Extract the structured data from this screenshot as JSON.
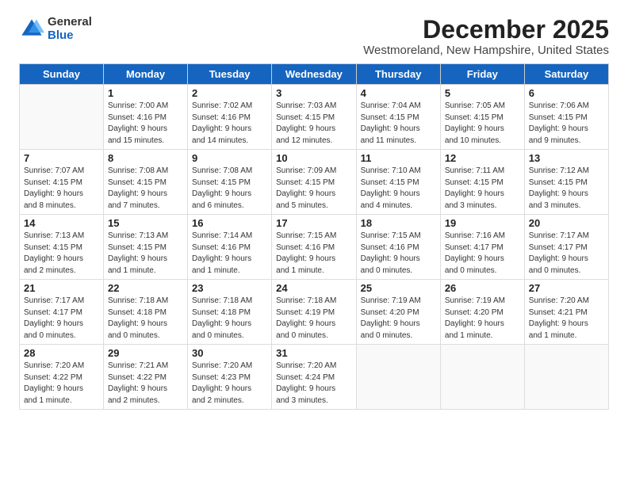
{
  "logo": {
    "general": "General",
    "blue": "Blue"
  },
  "title": "December 2025",
  "subtitle": "Westmoreland, New Hampshire, United States",
  "days_of_week": [
    "Sunday",
    "Monday",
    "Tuesday",
    "Wednesday",
    "Thursday",
    "Friday",
    "Saturday"
  ],
  "weeks": [
    [
      {
        "day": "",
        "info": ""
      },
      {
        "day": "1",
        "info": "Sunrise: 7:00 AM\nSunset: 4:16 PM\nDaylight: 9 hours\nand 15 minutes."
      },
      {
        "day": "2",
        "info": "Sunrise: 7:02 AM\nSunset: 4:16 PM\nDaylight: 9 hours\nand 14 minutes."
      },
      {
        "day": "3",
        "info": "Sunrise: 7:03 AM\nSunset: 4:15 PM\nDaylight: 9 hours\nand 12 minutes."
      },
      {
        "day": "4",
        "info": "Sunrise: 7:04 AM\nSunset: 4:15 PM\nDaylight: 9 hours\nand 11 minutes."
      },
      {
        "day": "5",
        "info": "Sunrise: 7:05 AM\nSunset: 4:15 PM\nDaylight: 9 hours\nand 10 minutes."
      },
      {
        "day": "6",
        "info": "Sunrise: 7:06 AM\nSunset: 4:15 PM\nDaylight: 9 hours\nand 9 minutes."
      }
    ],
    [
      {
        "day": "7",
        "info": "Sunrise: 7:07 AM\nSunset: 4:15 PM\nDaylight: 9 hours\nand 8 minutes."
      },
      {
        "day": "8",
        "info": "Sunrise: 7:08 AM\nSunset: 4:15 PM\nDaylight: 9 hours\nand 7 minutes."
      },
      {
        "day": "9",
        "info": "Sunrise: 7:08 AM\nSunset: 4:15 PM\nDaylight: 9 hours\nand 6 minutes."
      },
      {
        "day": "10",
        "info": "Sunrise: 7:09 AM\nSunset: 4:15 PM\nDaylight: 9 hours\nand 5 minutes."
      },
      {
        "day": "11",
        "info": "Sunrise: 7:10 AM\nSunset: 4:15 PM\nDaylight: 9 hours\nand 4 minutes."
      },
      {
        "day": "12",
        "info": "Sunrise: 7:11 AM\nSunset: 4:15 PM\nDaylight: 9 hours\nand 3 minutes."
      },
      {
        "day": "13",
        "info": "Sunrise: 7:12 AM\nSunset: 4:15 PM\nDaylight: 9 hours\nand 3 minutes."
      }
    ],
    [
      {
        "day": "14",
        "info": "Sunrise: 7:13 AM\nSunset: 4:15 PM\nDaylight: 9 hours\nand 2 minutes."
      },
      {
        "day": "15",
        "info": "Sunrise: 7:13 AM\nSunset: 4:15 PM\nDaylight: 9 hours\nand 1 minute."
      },
      {
        "day": "16",
        "info": "Sunrise: 7:14 AM\nSunset: 4:16 PM\nDaylight: 9 hours\nand 1 minute."
      },
      {
        "day": "17",
        "info": "Sunrise: 7:15 AM\nSunset: 4:16 PM\nDaylight: 9 hours\nand 1 minute."
      },
      {
        "day": "18",
        "info": "Sunrise: 7:15 AM\nSunset: 4:16 PM\nDaylight: 9 hours\nand 0 minutes."
      },
      {
        "day": "19",
        "info": "Sunrise: 7:16 AM\nSunset: 4:17 PM\nDaylight: 9 hours\nand 0 minutes."
      },
      {
        "day": "20",
        "info": "Sunrise: 7:17 AM\nSunset: 4:17 PM\nDaylight: 9 hours\nand 0 minutes."
      }
    ],
    [
      {
        "day": "21",
        "info": "Sunrise: 7:17 AM\nSunset: 4:17 PM\nDaylight: 9 hours\nand 0 minutes."
      },
      {
        "day": "22",
        "info": "Sunrise: 7:18 AM\nSunset: 4:18 PM\nDaylight: 9 hours\nand 0 minutes."
      },
      {
        "day": "23",
        "info": "Sunrise: 7:18 AM\nSunset: 4:18 PM\nDaylight: 9 hours\nand 0 minutes."
      },
      {
        "day": "24",
        "info": "Sunrise: 7:18 AM\nSunset: 4:19 PM\nDaylight: 9 hours\nand 0 minutes."
      },
      {
        "day": "25",
        "info": "Sunrise: 7:19 AM\nSunset: 4:20 PM\nDaylight: 9 hours\nand 0 minutes."
      },
      {
        "day": "26",
        "info": "Sunrise: 7:19 AM\nSunset: 4:20 PM\nDaylight: 9 hours\nand 1 minute."
      },
      {
        "day": "27",
        "info": "Sunrise: 7:20 AM\nSunset: 4:21 PM\nDaylight: 9 hours\nand 1 minute."
      }
    ],
    [
      {
        "day": "28",
        "info": "Sunrise: 7:20 AM\nSunset: 4:22 PM\nDaylight: 9 hours\nand 1 minute."
      },
      {
        "day": "29",
        "info": "Sunrise: 7:21 AM\nSunset: 4:22 PM\nDaylight: 9 hours\nand 2 minutes."
      },
      {
        "day": "30",
        "info": "Sunrise: 7:20 AM\nSunset: 4:23 PM\nDaylight: 9 hours\nand 2 minutes."
      },
      {
        "day": "31",
        "info": "Sunrise: 7:20 AM\nSunset: 4:24 PM\nDaylight: 9 hours\nand 3 minutes."
      },
      {
        "day": "",
        "info": ""
      },
      {
        "day": "",
        "info": ""
      },
      {
        "day": "",
        "info": ""
      }
    ]
  ]
}
